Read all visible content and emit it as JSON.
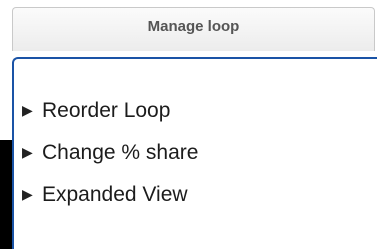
{
  "header": {
    "title": "Manage loop"
  },
  "menu": {
    "items": [
      {
        "label": "Reorder Loop",
        "icon": "right-triangle-icon"
      },
      {
        "label": "Change % share",
        "icon": "right-triangle-icon"
      },
      {
        "label": "Expanded View",
        "icon": "right-triangle-icon"
      }
    ],
    "arrow_glyph": "▶"
  },
  "colors": {
    "panel_border": "#1a53a6",
    "header_text": "#555555",
    "item_text": "#1c1c1c"
  }
}
